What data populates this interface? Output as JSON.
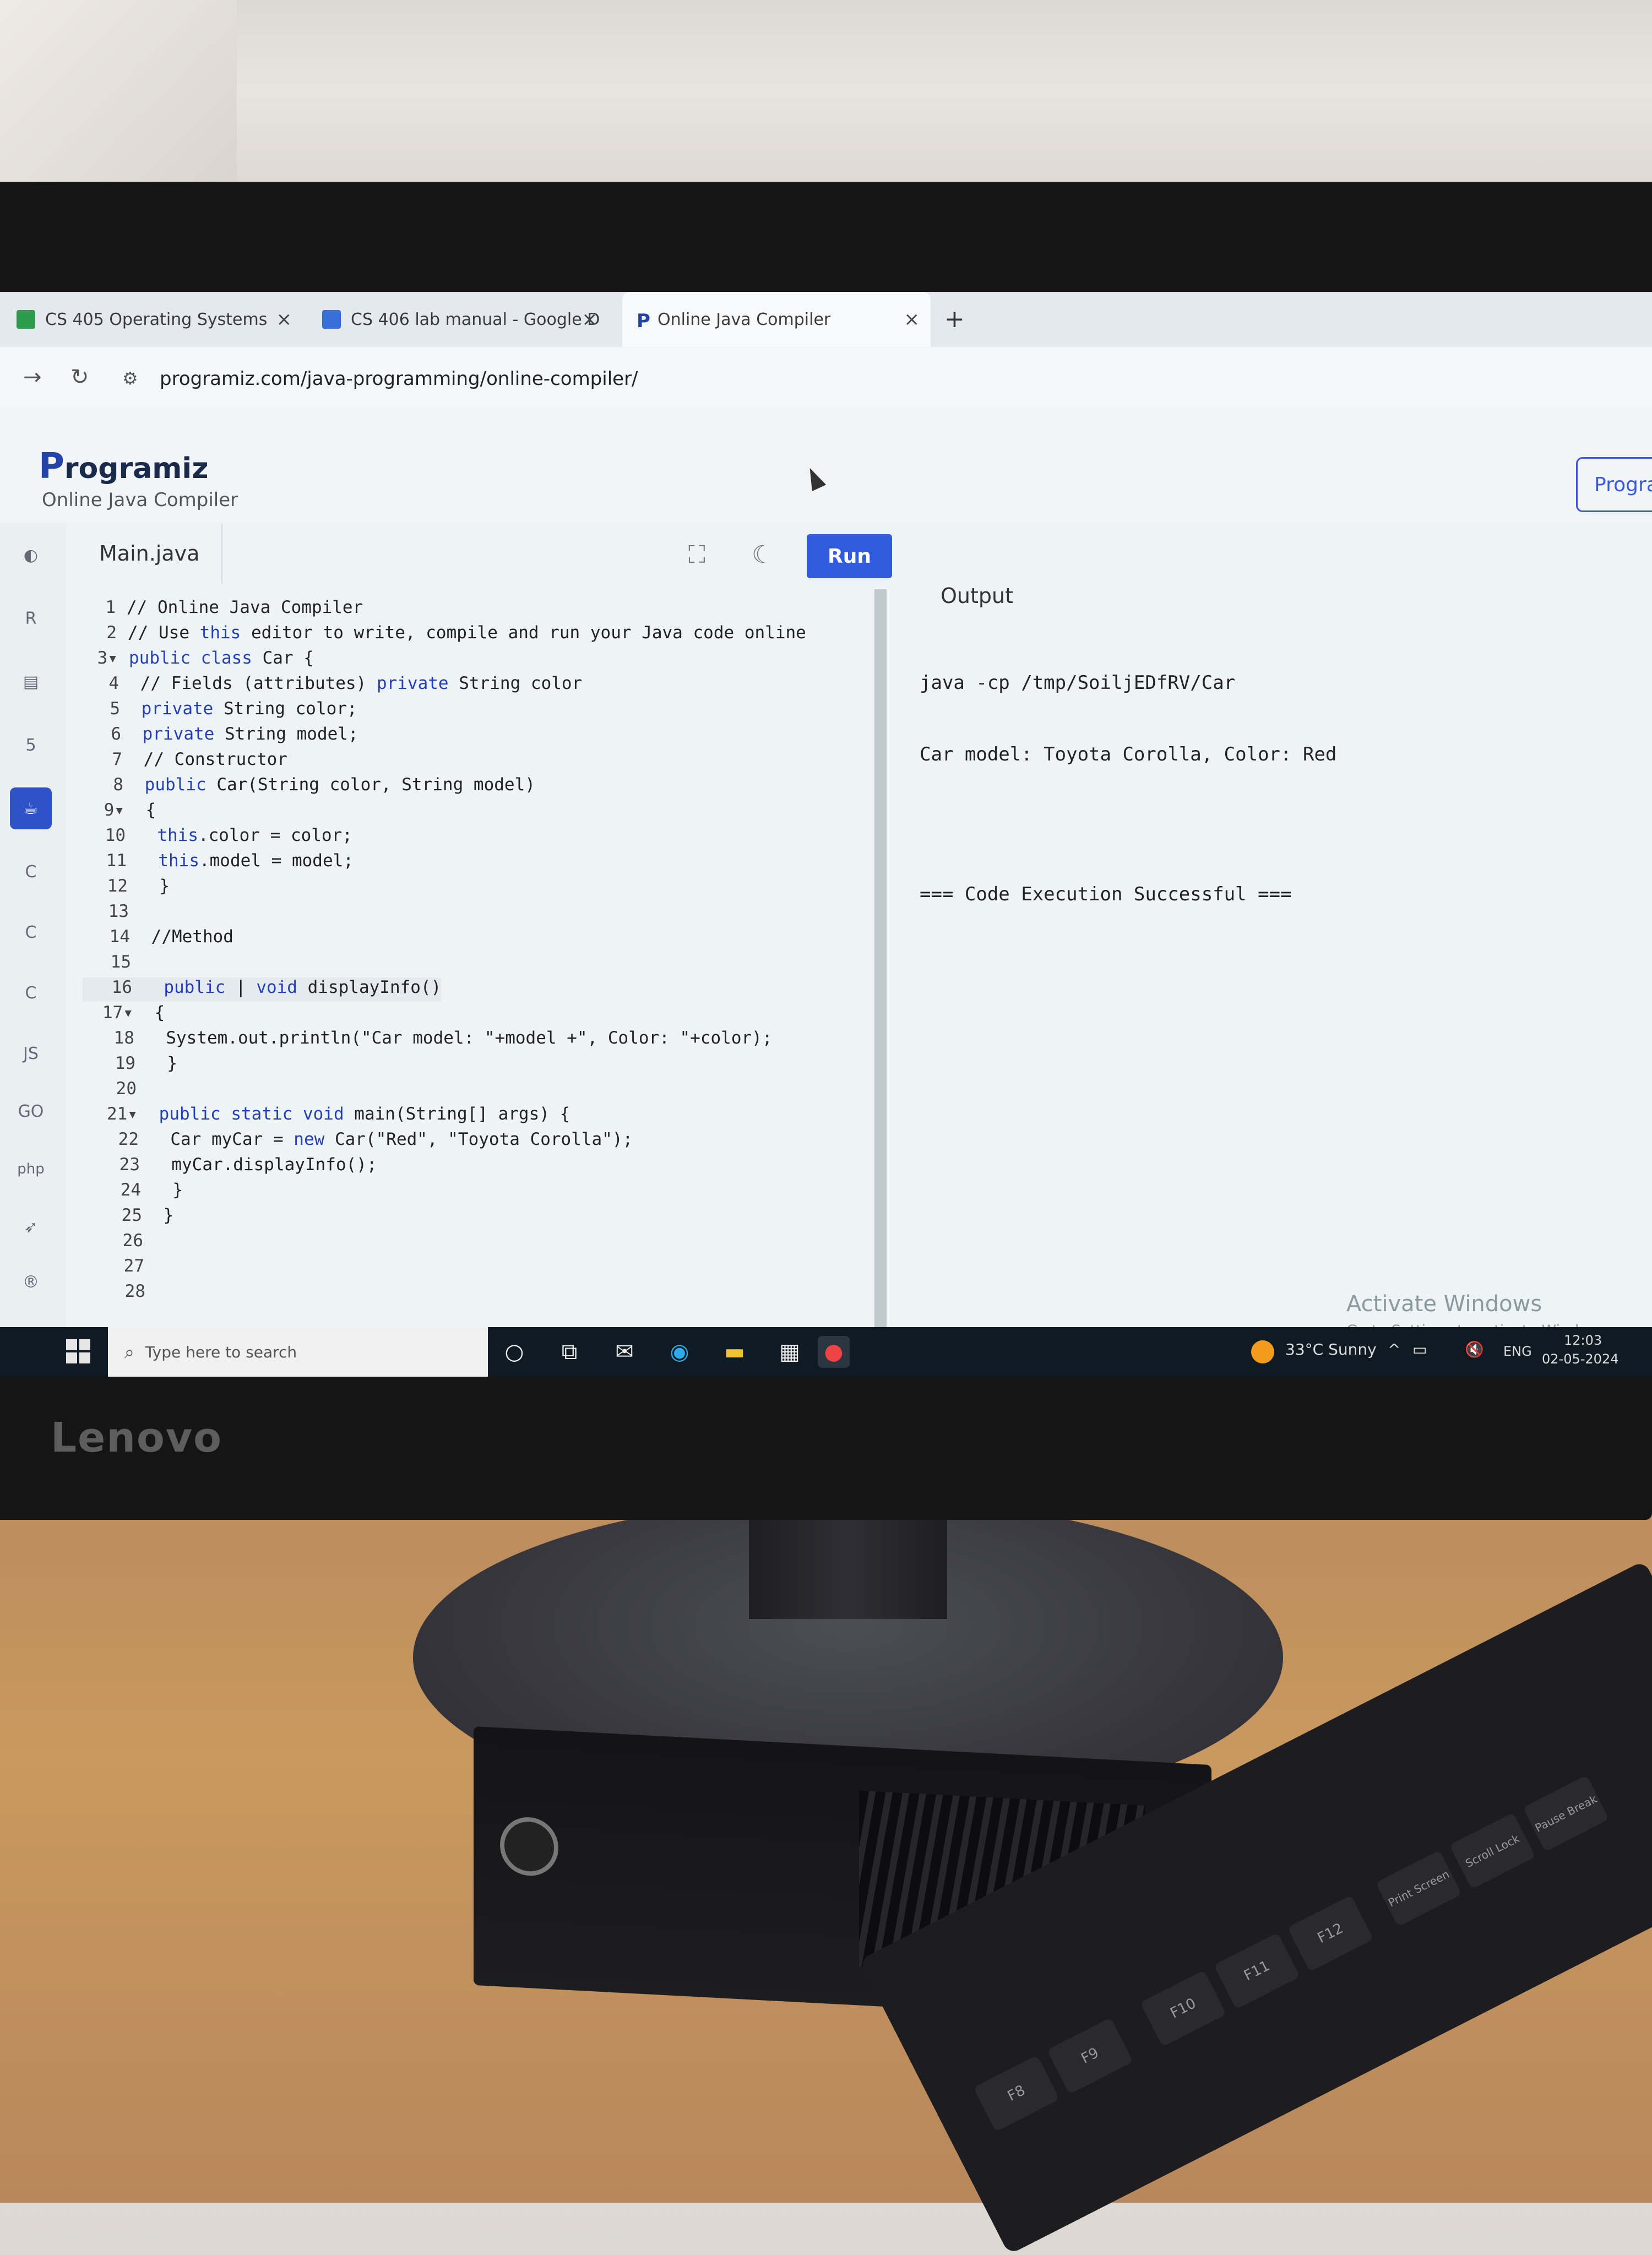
{
  "browser": {
    "tabs": [
      {
        "label": "CS 405 Operating Systems",
        "color": "#2e9a4c"
      },
      {
        "label": "CS 406 lab manual - Google D",
        "color": "#3a6ed8"
      },
      {
        "label": "Online Java Compiler",
        "color": "#2244aa"
      }
    ],
    "new_tab": "+",
    "close": "×",
    "url": "programiz.com/java-programming/online-compiler/"
  },
  "site": {
    "logo": "rogramiz",
    "logo_initial": "P",
    "tagline": "Online Java Compiler",
    "header_button": "Progra"
  },
  "languages": [
    "python-icon",
    "r-icon",
    "sql-icon",
    "html-icon",
    "java-icon",
    "c-icon",
    "csharp-icon",
    "cpp-icon",
    "JS",
    "GO",
    "php",
    "swift-icon",
    "rust-icon"
  ],
  "editor": {
    "file_tab": "Main.java",
    "run_label": "Run",
    "output_label": "Output",
    "lines": [
      "// Online Java Compiler",
      "// Use this editor to write, compile and run your Java code online",
      "public class Car {",
      " // Fields (attributes) private String color",
      " private String color;",
      " private String model;",
      " // Constructor",
      " public Car(String color, String model)",
      " {",
      "  this.color = color;",
      "  this.model = model;",
      "  }",
      "",
      " //Method",
      "",
      "  public | void displayInfo()",
      " {",
      "  System.out.println(\"Car model: \"+model +\", Color: \"+color);",
      "  }",
      "",
      " public static void main(String[] args) {",
      "  Car myCar = new Car(\"Red\", \"Toyota Corolla\");",
      "  myCar.displayInfo();",
      "  }",
      " }",
      "",
      "",
      ""
    ],
    "folded_lines": [
      3,
      9,
      17,
      21
    ]
  },
  "output": {
    "lines": [
      "java -cp /tmp/SoiljEDfRV/Car",
      "Car model: Toyota Corolla, Color: Red",
      "",
      "=== Code Execution Successful ==="
    ]
  },
  "watermark": {
    "line1": "Activate Windows",
    "line2": "Go to Settings to activate Windows."
  },
  "taskbar": {
    "search_placeholder": "Type here to search",
    "weather": "33°C  Sunny",
    "lang": "ENG",
    "time": "12:03",
    "date": "02-05-2024"
  },
  "monitor": {
    "brand": "Lenovo"
  },
  "keyboard_keys": [
    "F8",
    "F9",
    "F10",
    "F11",
    "F12",
    "Print Screen",
    "Scroll Lock",
    "Pause Break"
  ]
}
